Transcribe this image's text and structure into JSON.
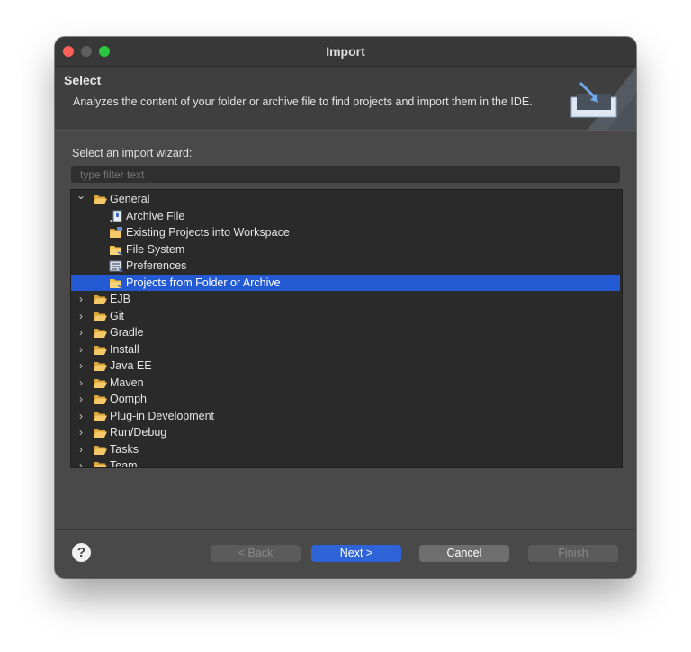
{
  "window": {
    "title": "Import"
  },
  "header": {
    "title": "Select",
    "description": "Analyzes the content of your folder or archive file to find projects and import them in the IDE."
  },
  "wizard": {
    "label": "Select an import wizard:",
    "filter_placeholder": "type filter text",
    "tree": [
      {
        "label": "General",
        "level": 0,
        "expanded": true,
        "icon": "folder-open-icon"
      },
      {
        "label": "Archive File",
        "level": 1,
        "icon": "archive-file-icon"
      },
      {
        "label": "Existing Projects into Workspace",
        "level": 1,
        "icon": "projects-folder-icon"
      },
      {
        "label": "File System",
        "level": 1,
        "icon": "folder-icon"
      },
      {
        "label": "Preferences",
        "level": 1,
        "icon": "preferences-icon"
      },
      {
        "label": "Projects from Folder or Archive",
        "level": 1,
        "icon": "folder-icon",
        "selected": true
      },
      {
        "label": "EJB",
        "level": 0,
        "expanded": false,
        "icon": "folder-open-icon"
      },
      {
        "label": "Git",
        "level": 0,
        "expanded": false,
        "icon": "folder-open-icon"
      },
      {
        "label": "Gradle",
        "level": 0,
        "expanded": false,
        "icon": "folder-open-icon"
      },
      {
        "label": "Install",
        "level": 0,
        "expanded": false,
        "icon": "folder-open-icon"
      },
      {
        "label": "Java EE",
        "level": 0,
        "expanded": false,
        "icon": "folder-open-icon"
      },
      {
        "label": "Maven",
        "level": 0,
        "expanded": false,
        "icon": "folder-open-icon"
      },
      {
        "label": "Oomph",
        "level": 0,
        "expanded": false,
        "icon": "folder-open-icon"
      },
      {
        "label": "Plug-in Development",
        "level": 0,
        "expanded": false,
        "icon": "folder-open-icon"
      },
      {
        "label": "Run/Debug",
        "level": 0,
        "expanded": false,
        "icon": "folder-open-icon"
      },
      {
        "label": "Tasks",
        "level": 0,
        "expanded": false,
        "icon": "folder-open-icon"
      },
      {
        "label": "Team",
        "level": 0,
        "expanded": false,
        "icon": "folder-open-icon"
      }
    ]
  },
  "buttons": {
    "help": "?",
    "back": "< Back",
    "next": "Next >",
    "cancel": "Cancel",
    "finish": "Finish"
  },
  "colors": {
    "selection": "#2359d3",
    "primary_button": "#2f63d8",
    "folder": "#f0c14b"
  }
}
